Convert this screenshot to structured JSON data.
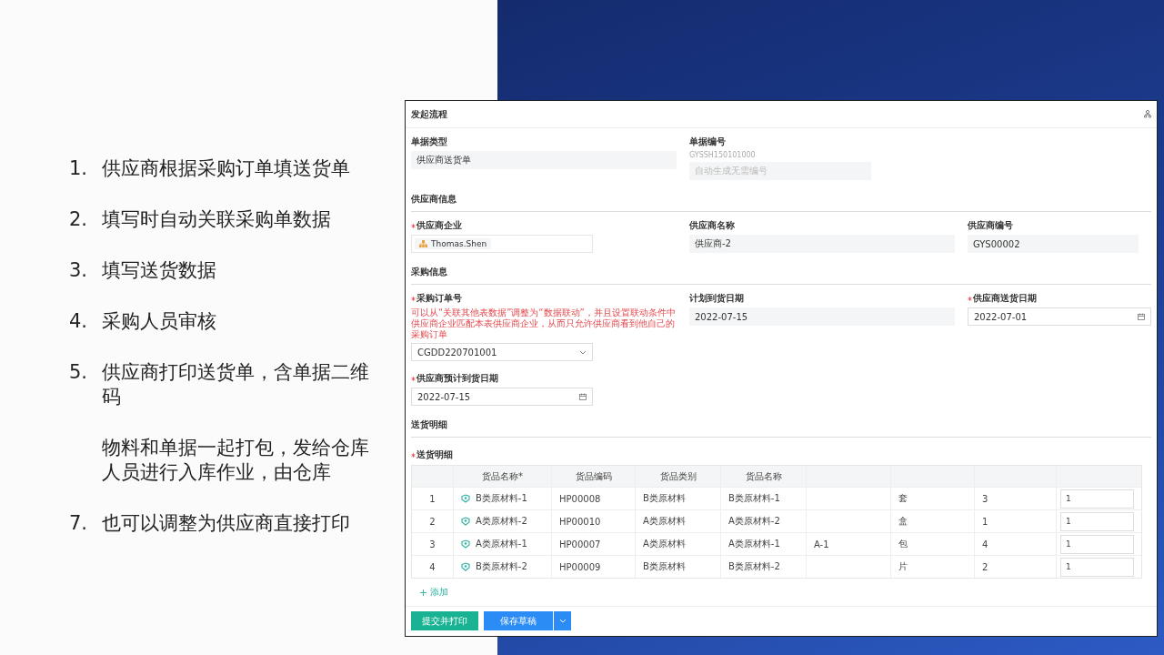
{
  "slide": {
    "steps": [
      {
        "number": "1.",
        "text": "供应商根据采购订单填送货单"
      },
      {
        "number": "2.",
        "text": "填写时自动关联采购单数据"
      },
      {
        "number": "3.",
        "text": "填写送货数据"
      },
      {
        "number": "4.",
        "text": "采购人员审核"
      },
      {
        "number": "5.",
        "text": "供应商打印送货单，含单据二维码"
      },
      {
        "text": "物料和单据一起打包，发给仓库人员进行入库作业，由仓库"
      },
      {
        "number": "7.",
        "text": "也可以调整为供应商直接打印"
      }
    ]
  },
  "window": {
    "title": "发起流程"
  },
  "sections": [
    {
      "rows": [
        [
          {
            "label": "单据类型",
            "kind": "readonly",
            "value": "供应商送货单"
          },
          {
            "label": "单据编号",
            "kind": "auto",
            "code": "GYSSH150101000",
            "placeholder": "自动生成无需编号"
          }
        ]
      ]
    },
    {
      "title": "供应商信息",
      "rows": [
        [
          {
            "label": "供应商企业",
            "required": true,
            "kind": "member",
            "value": "Thomas.Shen"
          },
          {
            "label": "供应商名称",
            "kind": "readonly",
            "value": "供应商-2"
          },
          {
            "label": "供应商编号",
            "kind": "readonly",
            "value": "GYS00002"
          }
        ]
      ]
    },
    {
      "title": "采购信息",
      "rows": [
        [
          {
            "label": "采购订单号",
            "required": true,
            "kind": "select",
            "hint": "可以从“关联其他表数据”调整为“数据联动”，并且设置联动条件中供应商企业匹配本表供应商企业，从而只允许供应商看到他自己的采购订单",
            "value": "CGDD220701001"
          },
          {
            "label": "计划到货日期",
            "kind": "readonly",
            "value": "2022-07-15"
          },
          {
            "label": "供应商送货日期",
            "required": true,
            "kind": "date",
            "value": "2022-07-01"
          }
        ],
        [
          {
            "label": "供应商预计到货日期",
            "required": true,
            "kind": "date",
            "value": "2022-07-15"
          }
        ]
      ]
    },
    {
      "title": "送货明细"
    }
  ],
  "table": {
    "label": "送货明细",
    "required": true,
    "columns": [
      "货品名称*",
      "货品编码",
      "货品类别",
      "货品名称"
    ],
    "rows": [
      {
        "index": "1",
        "item": "B类原材料-1",
        "code": "HP00008",
        "category": "B类原材料",
        "product_name": "B类原材料-1",
        "column_7": "套",
        "column_8": "3",
        "column_9": "1"
      },
      {
        "index": "2",
        "item": "A类原材料-2",
        "code": "HP00010",
        "category": "A类原材料",
        "product_name": "A类原材料-2",
        "column_7": "盒",
        "column_8": "1",
        "column_9": "1"
      },
      {
        "index": "3",
        "item": "A类原材料-1",
        "code": "HP00007",
        "category": "A类原材料",
        "product_name": "A类原材料-1",
        "column_6": "A-1",
        "column_7": "包",
        "column_8": "4",
        "column_9": "1"
      },
      {
        "index": "4",
        "item": "B类原材料-2",
        "code": "HP00009",
        "category": "B类原材料",
        "product_name": "B类原材料-2",
        "column_7": "片",
        "column_8": "2",
        "column_9": "1"
      }
    ],
    "add_label": "添加"
  },
  "buttons": [
    {
      "label": "提交并打印",
      "kind": "green"
    },
    {
      "label": "保存草稿",
      "kind": "blue",
      "dropdown": true
    }
  ]
}
